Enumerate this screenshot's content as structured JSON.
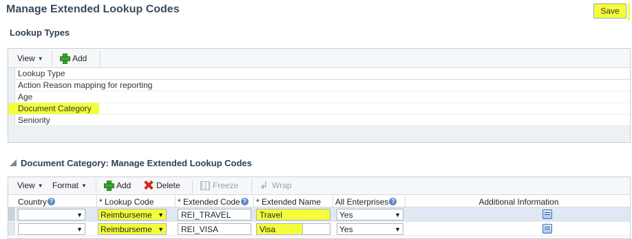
{
  "header": {
    "title": "Manage Extended Lookup Codes",
    "save_label": "Save"
  },
  "lookup_types": {
    "section_title": "Lookup Types",
    "toolbar": {
      "view_label": "View",
      "add_label": "Add"
    },
    "column_header": "Lookup Type",
    "rows": [
      "Action Reason mapping for reporting",
      "Age",
      "Document Category",
      "Seniority"
    ],
    "selected_row": "Document Category"
  },
  "codes": {
    "section_title": "Document Category: Manage Extended Lookup Codes",
    "toolbar": {
      "view_label": "View",
      "format_label": "Format",
      "add_label": "Add",
      "delete_label": "Delete",
      "freeze_label": "Freeze",
      "wrap_label": "Wrap"
    },
    "columns": {
      "country": "Country",
      "lookup_code": "* Lookup Code",
      "extended_code": "* Extended Code",
      "extended_name": "* Extended Name",
      "all_enterprises": "All Enterprises",
      "additional_info": "Additional Information"
    },
    "rows": [
      {
        "country": "",
        "lookup_code": "Reimburseme",
        "extended_code": "REI_TRAVEL",
        "extended_name": "Travel",
        "all_enterprises": "Yes"
      },
      {
        "country": "",
        "lookup_code": "Reimburseme",
        "extended_code": "REI_VISA",
        "extended_name": "Visa",
        "all_enterprises": "Yes"
      }
    ]
  },
  "colors": {
    "highlight": "#f4ff3a",
    "title": "#3a4b5c",
    "selected_row": "#dfe8f3"
  }
}
